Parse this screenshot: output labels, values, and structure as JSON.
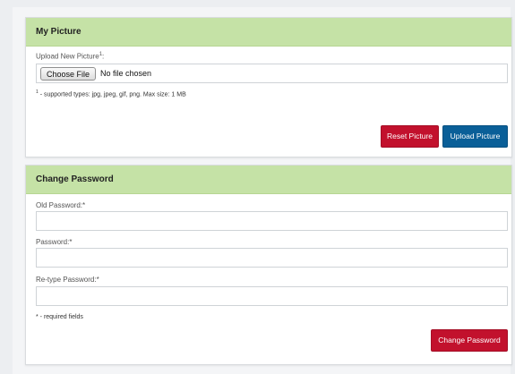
{
  "picture_panel": {
    "title": "My Picture",
    "upload_label": "Upload New Picture",
    "upload_footnote_mark": "1",
    "upload_label_suffix": ":",
    "choose_file_label": "Choose File",
    "file_status": "No file chosen",
    "note_mark": "1",
    "note_text": " - supported types: jpg, jpeg, gif, png. Max size: 1 MB",
    "reset_label": "Reset Picture",
    "upload_button_label": "Upload Picture"
  },
  "password_panel": {
    "title": "Change Password",
    "old_password_label": "Old Password:*",
    "password_label": "Password:*",
    "retype_label": "Re-type Password:*",
    "required_note": "* - required fields",
    "submit_label": "Change Password"
  },
  "colors": {
    "panel_header": "#c5e2a6",
    "danger": "#c2112d",
    "primary": "#0a5f98"
  }
}
